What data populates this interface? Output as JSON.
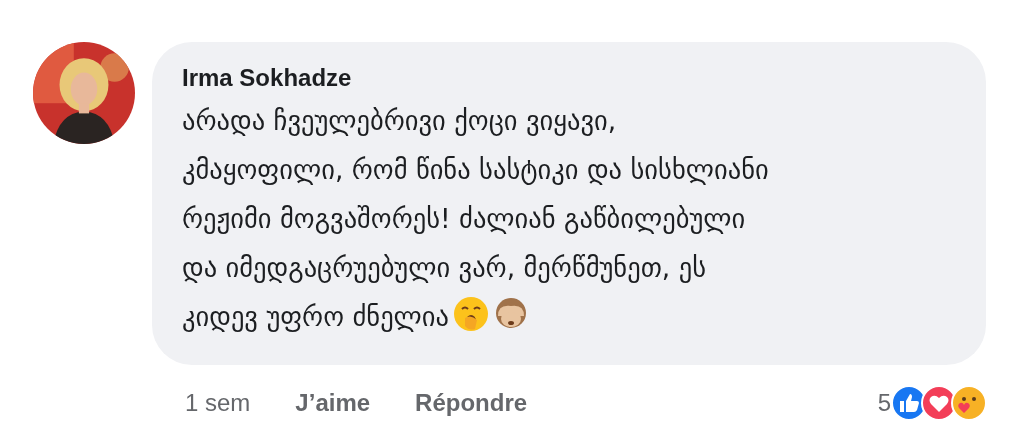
{
  "comment": {
    "author": "Irma Sokhadze",
    "text": "არადა ჩვეულებრივი ქოცი ვიყავი,\nკმაყოფილი, რომ წინა სასტიკი და სისხლიანი\nრეჟიმი მოგვაშორეს! ძალიან გაწბილებული\nდა იმედგაცრუებული ვარ, მერწმუნეთ, ეს\nკიდევ უფრო ძნელია",
    "emojis": [
      {
        "kind": "yawn"
      },
      {
        "kind": "monkey"
      }
    ],
    "time": "1 sem",
    "actions": [
      "J’aime",
      "Répondre"
    ],
    "reaction_count": "5",
    "reactions": [
      {
        "kind": "like"
      },
      {
        "kind": "love"
      },
      {
        "kind": "care"
      }
    ]
  }
}
